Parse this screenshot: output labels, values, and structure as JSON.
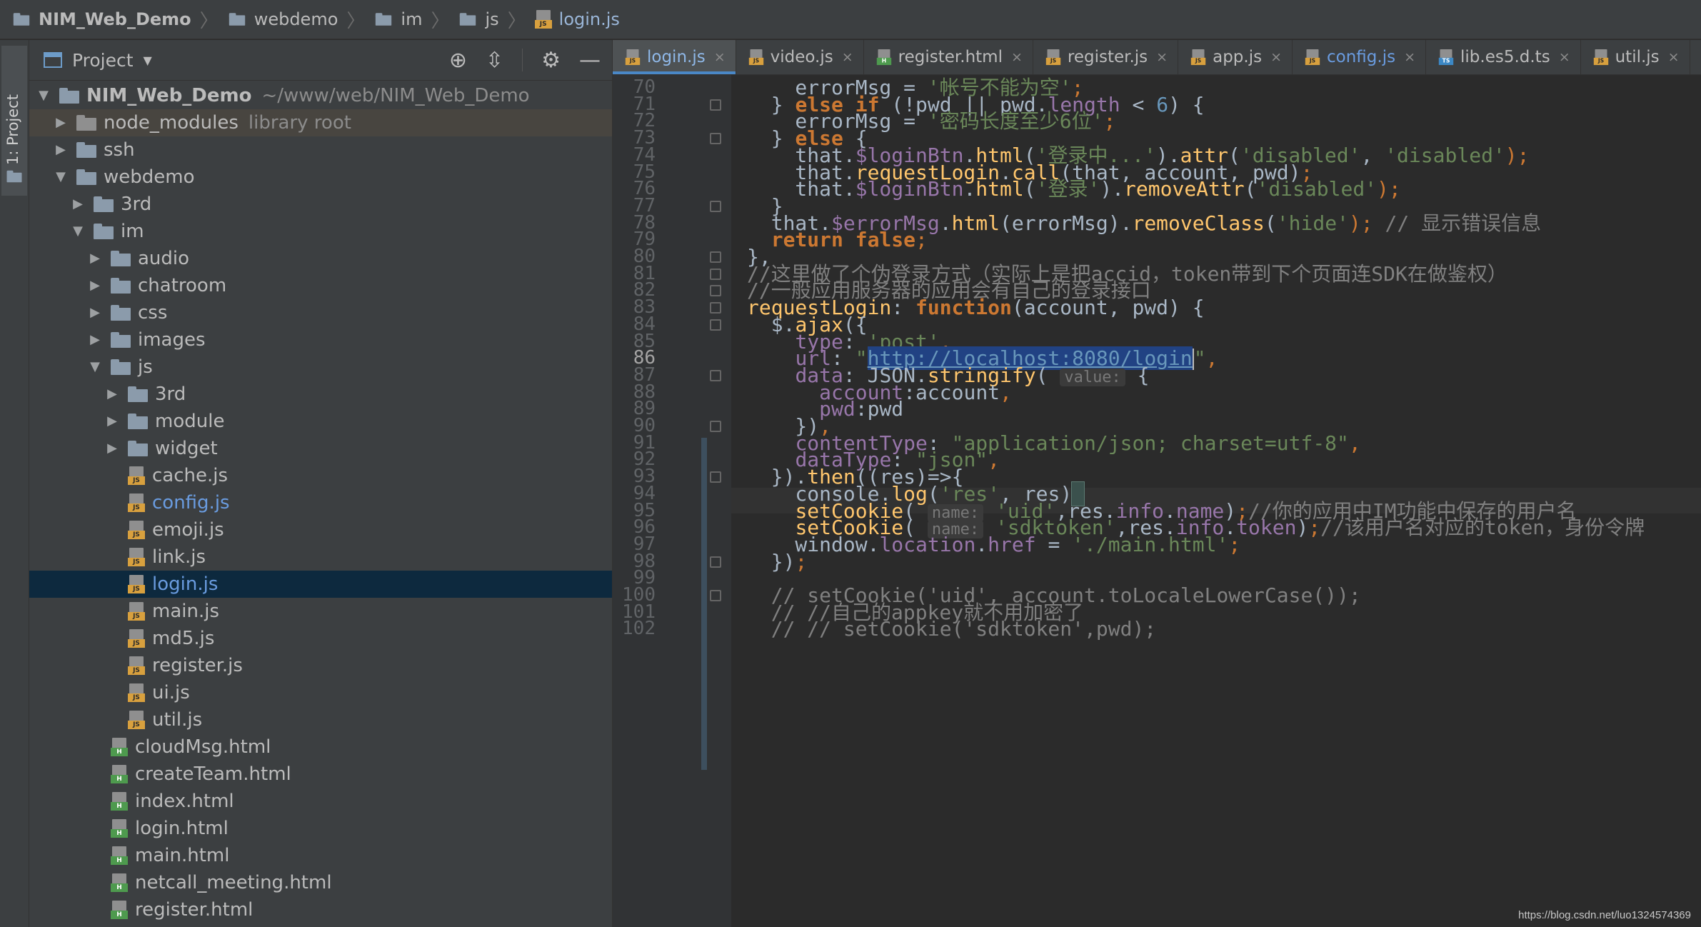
{
  "breadcrumb": [
    {
      "label": "NIM_Web_Demo",
      "icon": "folder-icon"
    },
    {
      "label": "webdemo",
      "icon": "folder-icon"
    },
    {
      "label": "im",
      "icon": "folder-icon"
    },
    {
      "label": "js",
      "icon": "folder-icon"
    },
    {
      "label": "login.js",
      "icon": "js-file-icon"
    }
  ],
  "stripe": {
    "label": "1: Project"
  },
  "project_panel": {
    "title": "Project",
    "tree": [
      {
        "label": "NIM_Web_Demo",
        "extra": "~/www/web/NIM_Web_Demo",
        "depth": 0,
        "arrow": "down",
        "type": "folder",
        "bold": true
      },
      {
        "label": "node_modules",
        "extra": "library root",
        "depth": 1,
        "arrow": "right",
        "type": "libfolder",
        "libroot": true
      },
      {
        "label": "ssh",
        "depth": 1,
        "arrow": "right",
        "type": "folder"
      },
      {
        "label": "webdemo",
        "depth": 1,
        "arrow": "down",
        "type": "folder"
      },
      {
        "label": "3rd",
        "depth": 2,
        "arrow": "right",
        "type": "folder"
      },
      {
        "label": "im",
        "depth": 2,
        "arrow": "down",
        "type": "folder"
      },
      {
        "label": "audio",
        "depth": 3,
        "arrow": "right",
        "type": "folder"
      },
      {
        "label": "chatroom",
        "depth": 3,
        "arrow": "right",
        "type": "folder"
      },
      {
        "label": "css",
        "depth": 3,
        "arrow": "right",
        "type": "folder"
      },
      {
        "label": "images",
        "depth": 3,
        "arrow": "right",
        "type": "folder"
      },
      {
        "label": "js",
        "depth": 3,
        "arrow": "down",
        "type": "folder"
      },
      {
        "label": "3rd",
        "depth": 4,
        "arrow": "right",
        "type": "folder"
      },
      {
        "label": "module",
        "depth": 4,
        "arrow": "right",
        "type": "folder"
      },
      {
        "label": "widget",
        "depth": 4,
        "arrow": "right",
        "type": "folder"
      },
      {
        "label": "cache.js",
        "depth": 4,
        "arrow": "none",
        "type": "js"
      },
      {
        "label": "config.js",
        "depth": 4,
        "arrow": "none",
        "type": "js",
        "blue": true
      },
      {
        "label": "emoji.js",
        "depth": 4,
        "arrow": "none",
        "type": "js"
      },
      {
        "label": "link.js",
        "depth": 4,
        "arrow": "none",
        "type": "js"
      },
      {
        "label": "login.js",
        "depth": 4,
        "arrow": "none",
        "type": "js",
        "blue": true,
        "selected": true
      },
      {
        "label": "main.js",
        "depth": 4,
        "arrow": "none",
        "type": "js"
      },
      {
        "label": "md5.js",
        "depth": 4,
        "arrow": "none",
        "type": "js"
      },
      {
        "label": "register.js",
        "depth": 4,
        "arrow": "none",
        "type": "js"
      },
      {
        "label": "ui.js",
        "depth": 4,
        "arrow": "none",
        "type": "js"
      },
      {
        "label": "util.js",
        "depth": 4,
        "arrow": "none",
        "type": "js"
      },
      {
        "label": "cloudMsg.html",
        "depth": 3,
        "arrow": "none",
        "type": "html"
      },
      {
        "label": "createTeam.html",
        "depth": 3,
        "arrow": "none",
        "type": "html"
      },
      {
        "label": "index.html",
        "depth": 3,
        "arrow": "none",
        "type": "html"
      },
      {
        "label": "login.html",
        "depth": 3,
        "arrow": "none",
        "type": "html"
      },
      {
        "label": "main.html",
        "depth": 3,
        "arrow": "none",
        "type": "html"
      },
      {
        "label": "netcall_meeting.html",
        "depth": 3,
        "arrow": "none",
        "type": "html"
      },
      {
        "label": "register.html",
        "depth": 3,
        "arrow": "none",
        "type": "html"
      }
    ]
  },
  "tabs": [
    {
      "label": "login.js",
      "type": "js",
      "active": true
    },
    {
      "label": "video.js",
      "type": "js"
    },
    {
      "label": "register.html",
      "type": "html"
    },
    {
      "label": "register.js",
      "type": "js"
    },
    {
      "label": "app.js",
      "type": "js"
    },
    {
      "label": "config.js",
      "type": "js",
      "blue": true
    },
    {
      "label": "lib.es5.d.ts",
      "type": "ts"
    },
    {
      "label": "util.js",
      "type": "js"
    }
  ],
  "editor": {
    "current_line": 86,
    "lines": [
      {
        "n": 70,
        "segs": [
          [
            "    errorMsg = ",
            ""
          ],
          [
            "'帐号不能为空'",
            "str"
          ],
          [
            ";",
            "semi"
          ]
        ]
      },
      {
        "n": 71,
        "fold": true,
        "segs": [
          [
            "  } ",
            ""
          ],
          [
            "else if",
            "kw"
          ],
          [
            " (!pwd || pwd.",
            ""
          ],
          [
            "length",
            "prop"
          ],
          [
            " < ",
            ""
          ],
          [
            "6",
            "num"
          ],
          [
            ") {",
            ""
          ]
        ]
      },
      {
        "n": 72,
        "segs": [
          [
            "    errorMsg = ",
            ""
          ],
          [
            "'密码长度至少6位'",
            "str"
          ],
          [
            ";",
            "semi"
          ]
        ]
      },
      {
        "n": 73,
        "fold": true,
        "segs": [
          [
            "  } ",
            ""
          ],
          [
            "else",
            "kw"
          ],
          [
            " {",
            ""
          ]
        ]
      },
      {
        "n": 74,
        "segs": [
          [
            "    that.",
            ""
          ],
          [
            "$loginBtn",
            "prop"
          ],
          [
            ".",
            ""
          ],
          [
            "html",
            "fn"
          ],
          [
            "(",
            ""
          ],
          [
            "'登录中...'",
            "str"
          ],
          [
            ").",
            ""
          ],
          [
            "attr",
            "fn"
          ],
          [
            "(",
            ""
          ],
          [
            "'disabled'",
            "str"
          ],
          [
            ", ",
            ""
          ],
          [
            "'disabled'",
            "str"
          ],
          [
            ");",
            "semi"
          ]
        ]
      },
      {
        "n": 75,
        "segs": [
          [
            "    that.",
            ""
          ],
          [
            "requestLogin",
            "fn"
          ],
          [
            ".",
            ""
          ],
          [
            "call",
            "fn"
          ],
          [
            "(that, account, pwd)",
            ""
          ],
          [
            ";",
            "semi"
          ]
        ]
      },
      {
        "n": 76,
        "segs": [
          [
            "    that.",
            ""
          ],
          [
            "$loginBtn",
            "prop"
          ],
          [
            ".",
            ""
          ],
          [
            "html",
            "fn"
          ],
          [
            "(",
            ""
          ],
          [
            "'登录'",
            "str"
          ],
          [
            ").",
            ""
          ],
          [
            "removeAttr",
            "fn"
          ],
          [
            "(",
            ""
          ],
          [
            "'disabled'",
            "str"
          ],
          [
            ");",
            "semi"
          ]
        ]
      },
      {
        "n": 77,
        "fold": true,
        "segs": [
          [
            "  }",
            ""
          ]
        ]
      },
      {
        "n": 78,
        "segs": [
          [
            "  that.",
            ""
          ],
          [
            "$errorMsg",
            "prop"
          ],
          [
            ".",
            ""
          ],
          [
            "html",
            "fn"
          ],
          [
            "(errorMsg).",
            ""
          ],
          [
            "removeClass",
            "fn"
          ],
          [
            "(",
            ""
          ],
          [
            "'hide'",
            "str"
          ],
          [
            ");",
            "semi"
          ],
          [
            " // 显示错误信息",
            "cmt"
          ]
        ]
      },
      {
        "n": 79,
        "segs": [
          [
            "  ",
            ""
          ],
          [
            "return false",
            "kw"
          ],
          [
            ";",
            "semi"
          ]
        ]
      },
      {
        "n": 80,
        "fold": true,
        "segs": [
          [
            "},",
            ""
          ]
        ]
      },
      {
        "n": 81,
        "fold": true,
        "segs": [
          [
            "//这里做了个伪登录方式（实际上是把accid，token带到下个页面连SDK在做鉴权）",
            "cmt"
          ]
        ]
      },
      {
        "n": 82,
        "fold": true,
        "segs": [
          [
            "//一般应用服务器的应用会有自己的登录接口",
            "cmt"
          ]
        ]
      },
      {
        "n": 83,
        "fold": true,
        "segs": [
          [
            "requestLogin",
            "fn"
          ],
          [
            ": ",
            ""
          ],
          [
            "function",
            "kw"
          ],
          [
            "(account, pwd) {",
            ""
          ]
        ]
      },
      {
        "n": 84,
        "fold": true,
        "segs": [
          [
            "  $.",
            ""
          ],
          [
            "ajax",
            "fn"
          ],
          [
            "({",
            ""
          ]
        ]
      },
      {
        "n": 85,
        "segs": [
          [
            "    ",
            ""
          ],
          [
            "type",
            "prop"
          ],
          [
            ": ",
            ""
          ],
          [
            "'post'",
            "str"
          ],
          [
            ",",
            "semi"
          ]
        ]
      },
      {
        "n": 86,
        "segs": [
          [
            "    ",
            ""
          ],
          [
            "url",
            "prop"
          ],
          [
            ": ",
            ""
          ],
          [
            "\"",
            "str"
          ],
          [
            "http://localhost:8080/login",
            "sel"
          ],
          [
            "|",
            "caret"
          ],
          [
            "\"",
            "str"
          ],
          [
            ",",
            "semi"
          ]
        ]
      },
      {
        "n": 87,
        "fold": true,
        "segs": [
          [
            "    ",
            ""
          ],
          [
            "data",
            "prop"
          ],
          [
            ": JSON.",
            ""
          ],
          [
            "stringify",
            "fn"
          ],
          [
            "( ",
            ""
          ],
          [
            "value:",
            "hint"
          ],
          [
            " {",
            ""
          ]
        ]
      },
      {
        "n": 88,
        "segs": [
          [
            "      ",
            ""
          ],
          [
            "account",
            "prop"
          ],
          [
            ":account",
            ""
          ],
          [
            ",",
            "semi"
          ]
        ]
      },
      {
        "n": 89,
        "segs": [
          [
            "      ",
            ""
          ],
          [
            "pwd",
            "prop"
          ],
          [
            ":pwd",
            ""
          ]
        ]
      },
      {
        "n": 90,
        "fold": true,
        "segs": [
          [
            "    })",
            ""
          ],
          [
            ",",
            "semi"
          ]
        ]
      },
      {
        "n": 91,
        "segs": [
          [
            "    ",
            ""
          ],
          [
            "contentType",
            "prop"
          ],
          [
            ": ",
            ""
          ],
          [
            "\"application/json; charset=utf-8\"",
            "str"
          ],
          [
            ",",
            "semi"
          ]
        ]
      },
      {
        "n": 92,
        "segs": [
          [
            "    ",
            ""
          ],
          [
            "dataType",
            "prop"
          ],
          [
            ": ",
            ""
          ],
          [
            "\"json\"",
            "str"
          ],
          [
            ",",
            "semi"
          ]
        ]
      },
      {
        "n": 93,
        "fold": true,
        "segs": [
          [
            "  }).",
            ""
          ],
          [
            "then",
            "fn"
          ],
          [
            "((res)=>{",
            ""
          ]
        ]
      },
      {
        "n": 94,
        "segs": [
          [
            "    console.",
            ""
          ],
          [
            "log",
            "fn"
          ],
          [
            "(",
            ""
          ],
          [
            "'res'",
            "str"
          ],
          [
            ", res)",
            ""
          ],
          [
            " ",
            "brk"
          ]
        ]
      },
      {
        "n": 95,
        "segs": [
          [
            "    ",
            ""
          ],
          [
            "setCookie",
            "fn"
          ],
          [
            "( ",
            ""
          ],
          [
            "name:",
            "hint"
          ],
          [
            " ",
            ""
          ],
          [
            "'uid'",
            "str"
          ],
          [
            ",res.",
            ""
          ],
          [
            "info",
            "prop"
          ],
          [
            ".",
            ""
          ],
          [
            "name",
            "prop"
          ],
          [
            ")",
            ""
          ],
          [
            ";",
            "semi"
          ],
          [
            "//你的应用中IM功能中保存的用户名",
            "cmt"
          ]
        ]
      },
      {
        "n": 96,
        "segs": [
          [
            "    ",
            ""
          ],
          [
            "setCookie",
            "fn"
          ],
          [
            "( ",
            ""
          ],
          [
            "name:",
            "hint"
          ],
          [
            " ",
            ""
          ],
          [
            "'sdktoken'",
            "str"
          ],
          [
            ",res.",
            ""
          ],
          [
            "info",
            "prop"
          ],
          [
            ".",
            ""
          ],
          [
            "token",
            "prop"
          ],
          [
            ")",
            ""
          ],
          [
            ";",
            "semi"
          ],
          [
            "//该用户名对应的token，身份令牌",
            "cmt"
          ]
        ]
      },
      {
        "n": 97,
        "segs": [
          [
            "    window.",
            ""
          ],
          [
            "location",
            "prop"
          ],
          [
            ".",
            ""
          ],
          [
            "href",
            "prop"
          ],
          [
            " = ",
            ""
          ],
          [
            "'./main.html'",
            "str"
          ],
          [
            ";",
            "semi"
          ]
        ]
      },
      {
        "n": 98,
        "fold": true,
        "segs": [
          [
            "  })",
            ""
          ],
          [
            ";",
            "semi"
          ]
        ]
      },
      {
        "n": 99,
        "segs": [
          [
            "",
            ""
          ]
        ]
      },
      {
        "n": 100,
        "fold": true,
        "segs": [
          [
            "  // setCookie('uid', account.toLocaleLowerCase());",
            "cmt"
          ]
        ]
      },
      {
        "n": 101,
        "segs": [
          [
            "  // //自己的appkey就不用加密了",
            "cmt"
          ]
        ]
      },
      {
        "n": 102,
        "segs": [
          [
            "  // // setCookie('sdktoken',pwd);",
            "cmt"
          ]
        ]
      }
    ]
  },
  "watermark": "https://blog.csdn.net/luo1324574369"
}
